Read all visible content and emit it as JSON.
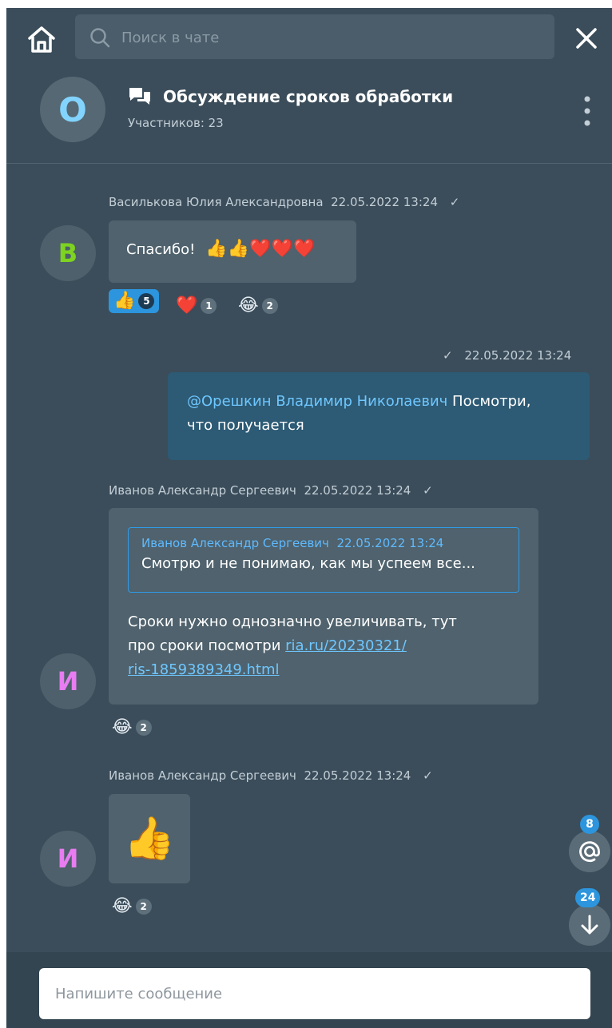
{
  "search": {
    "placeholder": "Поиск в чате"
  },
  "chat": {
    "avatar_letter": "О",
    "title": "Обсуждение сроков обработки",
    "participants": "Участников: 23"
  },
  "messages": [
    {
      "author": "Василькова Юлия Александровна",
      "time": "22.05.2022  13:24",
      "avatar_letter": "В",
      "text": "Спасибо!",
      "emojis": "👍👍❤️❤️❤️",
      "reactions": [
        {
          "emoji": "👍",
          "count": "5"
        },
        {
          "emoji": "❤️",
          "count": "1"
        },
        {
          "emoji": "😂",
          "count": "2"
        }
      ]
    },
    {
      "time": "22.05.2022  13:24",
      "mention": "@Орешкин Владимир Николаевич",
      "text_line1": " Посмотри,",
      "text_line2": "что получается"
    },
    {
      "author": "Иванов Александр Сергеевич",
      "time": "22.05.2022  13:24",
      "avatar_letter": "И",
      "quote": {
        "author": "Иванов Александр Сергеевич",
        "time": "22.05.2022  13:24",
        "text": "Смотрю и не понимаю, как мы успеем все..."
      },
      "text_line1": "Сроки нужно однозначно увеличивать, тут",
      "text_line2": "про сроки посмотри ",
      "link_part1": "ria.ru/20230321/",
      "link_part2": "ris-1859389349.html",
      "reactions": [
        {
          "emoji": "😂",
          "count": "2"
        }
      ]
    },
    {
      "author": "Иванов Александр Сергеевич",
      "time": "22.05.2022  13:24",
      "avatar_letter": "И",
      "sticker": "👍",
      "reactions": [
        {
          "emoji": "😂",
          "count": "2"
        }
      ]
    }
  ],
  "side": {
    "mentions_count": "8",
    "unread_count": "24"
  },
  "composer": {
    "placeholder": "Напишите сообщение"
  },
  "colors": {
    "accent": "#2c95dd",
    "background": "#3b4d5a",
    "avatar_v": "#7ed321",
    "avatar_i": "#e87cf0"
  }
}
